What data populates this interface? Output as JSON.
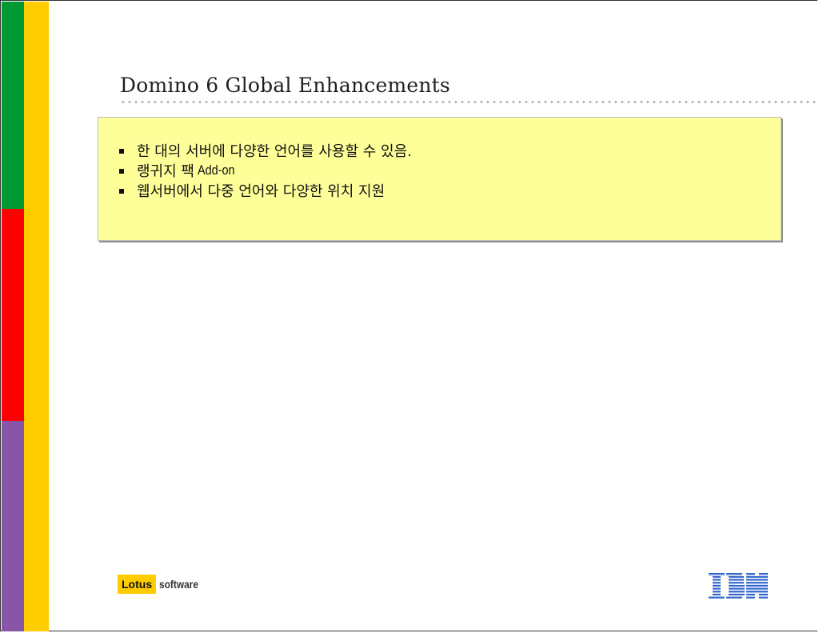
{
  "colors": {
    "bar_green": "#009933",
    "bar_red": "#ff0000",
    "bar_purple": "#8855a8",
    "bar_yellow": "#ffcc00",
    "content_bg": "#ffff99",
    "ibm_blue": "#3366cc"
  },
  "slide": {
    "title": "Domino 6 Global Enhancements",
    "bullets": [
      {
        "text": "한 대의 서버에 다양한 언어를 사용할 수 있음."
      },
      {
        "text": "랭귀지 팩",
        "suffix": "Add-on"
      },
      {
        "text": "웹서버에서 다중 언어와 다양한 위치 지원"
      }
    ]
  },
  "footer": {
    "lotus_label": "Lotus",
    "software_label": "software",
    "ibm_logo": "IBM"
  }
}
